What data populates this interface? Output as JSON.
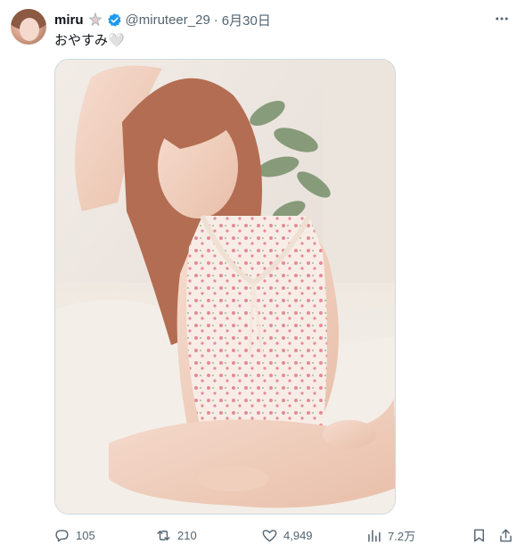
{
  "tweet": {
    "author_name": "miru",
    "handle": "@miruteer_29",
    "separator": "·",
    "date": "6月30日",
    "text": "おやすみ🤍"
  },
  "icons": {
    "avatar": "avatar",
    "name_decoration": "star-decoration-icon",
    "verified": "verified-badge-icon",
    "more": "more-options-icon"
  },
  "actions": {
    "reply_count": "105",
    "retweet_count": "210",
    "like_count": "4,949",
    "view_count": "7.2万"
  },
  "colors": {
    "verified": "#1d9bf0",
    "secondary_text": "#536471",
    "primary_text": "#0f1419"
  }
}
